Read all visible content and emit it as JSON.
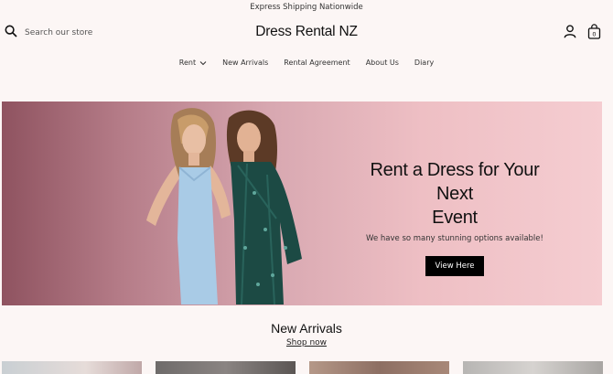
{
  "announcement": {
    "text": "Express Shipping Nationwide"
  },
  "header": {
    "logo": "Dress Rental NZ",
    "search": {
      "placeholder": "Search our store",
      "icon": "search-icon"
    },
    "account_icon": "account-icon",
    "cart": {
      "icon": "bag-icon",
      "count": "0"
    }
  },
  "nav": {
    "items": [
      {
        "label": "Rent",
        "has_dropdown": true
      },
      {
        "label": "New Arrivals"
      },
      {
        "label": "Rental Agreement"
      },
      {
        "label": "About Us"
      },
      {
        "label": "Diary"
      }
    ]
  },
  "hero": {
    "title_line1": "Rent a Dress for Your Next",
    "title_line2": "Event",
    "subtitle": "We have so many stunning options available!",
    "button_label": "View Here"
  },
  "new_arrivals": {
    "title": "New Arrivals",
    "link": "Shop now"
  },
  "colors": {
    "background": "#fcf6f5",
    "hero_left": "#8f5360",
    "hero_right": "#f5cdd1",
    "button": "#000000"
  }
}
